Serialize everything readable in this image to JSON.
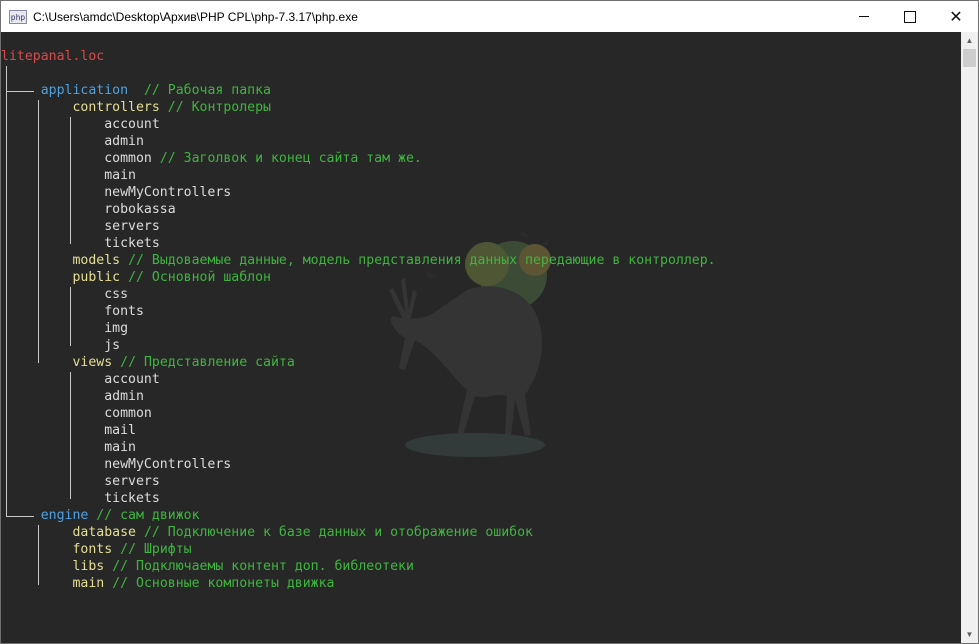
{
  "window": {
    "title": "C:\\Users\\amdc\\Desktop\\Архив\\PHP CPL\\php-7.3.17\\php.exe",
    "icon_text": "php",
    "minimize_icon": "minimize-icon",
    "maximize_icon": "maximize-icon",
    "close_icon": "close-icon",
    "close_glyph": "✕"
  },
  "scrollbar": {
    "up_glyph": "▲",
    "down_glyph": "▼"
  },
  "tree": {
    "root": "litepanal.loc",
    "application": {
      "name": "application",
      "comment": "// Рабочая папка"
    },
    "controllers": {
      "name": "controllers",
      "comment": "// Контролеры",
      "items": [
        {
          "name": "account",
          "comment": ""
        },
        {
          "name": "admin",
          "comment": ""
        },
        {
          "name": "common",
          "comment": "// Заголвок и конец сайта там же."
        },
        {
          "name": "main",
          "comment": ""
        },
        {
          "name": "newMyControllers",
          "comment": ""
        },
        {
          "name": "robokassa",
          "comment": ""
        },
        {
          "name": "servers",
          "comment": ""
        },
        {
          "name": "tickets",
          "comment": ""
        }
      ]
    },
    "models": {
      "name": "models",
      "comment": "// Выдоваемые данные, модель представления данных передающие в контроллер."
    },
    "public": {
      "name": "public",
      "comment": "// Основной шаблон",
      "items": [
        "css",
        "fonts",
        "img",
        "js"
      ]
    },
    "views": {
      "name": "views",
      "comment": "// Представление сайта",
      "items": [
        "account",
        "admin",
        "common",
        "mail",
        "main",
        "newMyControllers",
        "servers",
        "tickets"
      ]
    },
    "engine": {
      "name": "engine",
      "comment": "// сам движок",
      "items": [
        {
          "name": "database",
          "comment": "// Подключение к базе данных и отображение ошибок"
        },
        {
          "name": "fonts",
          "comment": "// Шрифты"
        },
        {
          "name": "libs",
          "comment": "// Подключаемы контент доп. библеотеки"
        },
        {
          "name": "main",
          "comment": "// Основные компонеты движка"
        }
      ]
    }
  },
  "colors": {
    "background": "#272727",
    "root": "#d94a4a",
    "folder_top": "#4ea1e0",
    "folder_sub": "#e6df95",
    "file": "#dcdcdc",
    "comment": "#3fb53f"
  }
}
